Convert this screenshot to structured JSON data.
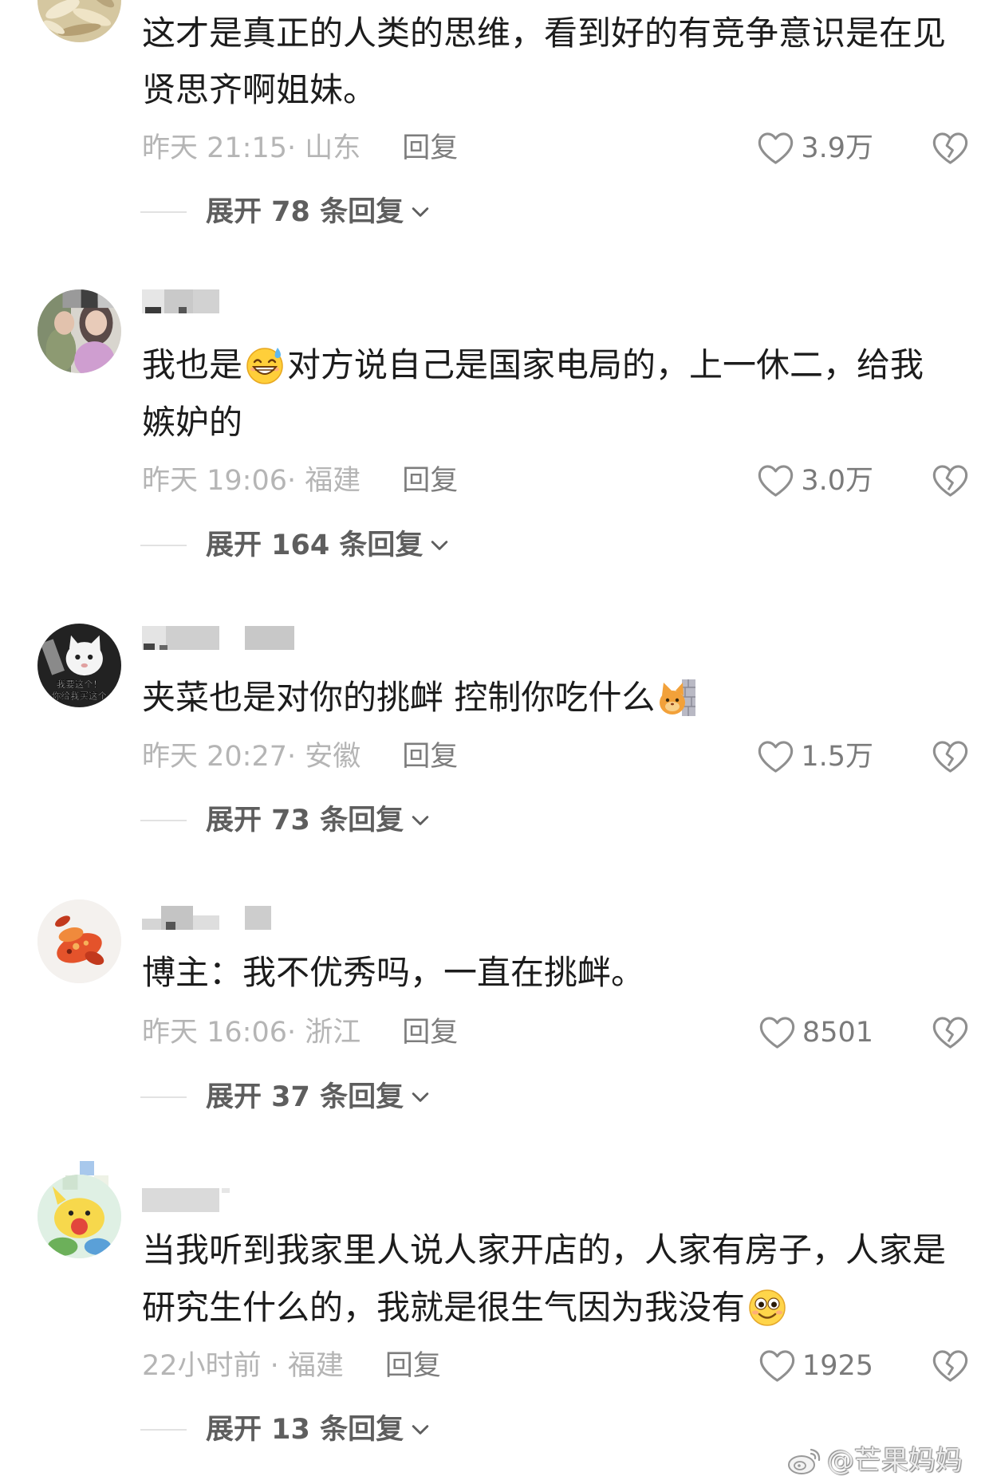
{
  "colors": {
    "comment_text": "#1c1c1c",
    "meta_text": "#b5b5b5",
    "reply_label": "#7d7d7d",
    "like_count": "#7a7a7a",
    "expand_label": "#5e5e5e",
    "divider": "#e2e2e2",
    "icon_stroke": "#8f8f8f"
  },
  "icons": {
    "like": "heart-icon",
    "dislike": "broken-heart-icon",
    "expand": "chevron-down-icon",
    "watermark_logo": "weibo-logo-icon"
  },
  "comments": [
    {
      "text": {
        "line1": "这才是真正的人类的思维，看到好的有竞争意识是在见",
        "line2": "贤思齐啊姐妹。"
      },
      "meta": "昨天 21:15· 山东",
      "reply_label": "回复",
      "likes": "3.9万",
      "expand_label": "展开 78 条回复"
    },
    {
      "text": {
        "line1_before": "我也是",
        "line1_emoji": "grinning-sweat-face-emoji",
        "line1_after": "对方说自己是国家电局的，上一休二，给我",
        "line2": "嫉妒的"
      },
      "meta": "昨天 19:06· 福建",
      "reply_label": "回复",
      "likes": "3.0万",
      "expand_label": "展开 164 条回复"
    },
    {
      "avatar_caption": [
        "我要这个！",
        "你给我买这个"
      ],
      "text": {
        "line1": "夹菜也是对你的挑衅 控制你吃什么",
        "line1_emoji": "peeking-cat-emoji"
      },
      "meta": "昨天 20:27· 安徽",
      "reply_label": "回复",
      "likes": "1.5万",
      "expand_label": "展开 73 条回复"
    },
    {
      "text": {
        "line1": "博主：我不优秀吗，一直在挑衅。"
      },
      "meta": "昨天 16:06· 浙江",
      "reply_label": "回复",
      "likes": "8501",
      "expand_label": "展开 37 条回复"
    },
    {
      "text": {
        "line1": "当我听到我家里人说人家开店的，人家有房子，人家是",
        "line2": "研究生什么的，我就是很生气因为我没有",
        "line2_emoji": "wide-eyed-smile-emoji"
      },
      "meta": "22小时前 · 福建",
      "reply_label": "回复",
      "likes": "1925",
      "expand_label": "展开 13 条回复"
    }
  ],
  "watermark": "@芒果妈妈"
}
